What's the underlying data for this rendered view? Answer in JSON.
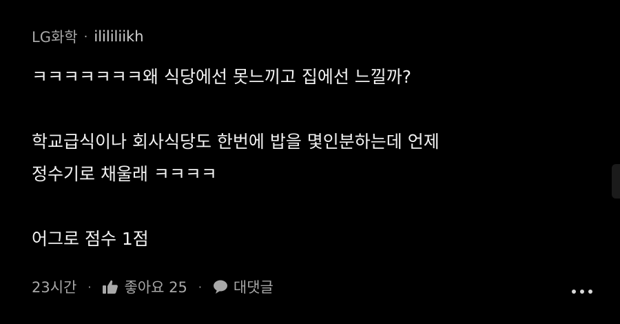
{
  "comment": {
    "author": "LG화학",
    "separator": "·",
    "username": "ilililiikh",
    "paragraphs": [
      "ㅋㅋㅋㅋㅋㅋㅋ왜 식당에선 못느끼고 집에선 느낄까?",
      "학교급식이나 회사식당도 한번에 밥을 몇인분하는데 언제",
      "정수기로 채울래 ㅋㅋㅋㅋ",
      "어그로 점수 1점"
    ],
    "footer": {
      "time": "23시간",
      "like_label": "좋아요 25",
      "reply_label": "대댓글",
      "dot": "·"
    },
    "icons": {
      "like": "thumbs-up-icon",
      "reply": "speech-bubble-icon",
      "more": "more-dots-icon"
    }
  },
  "colors": {
    "background": "#000000",
    "text": "#f2f2f2",
    "meta": "#a8a8a8"
  }
}
